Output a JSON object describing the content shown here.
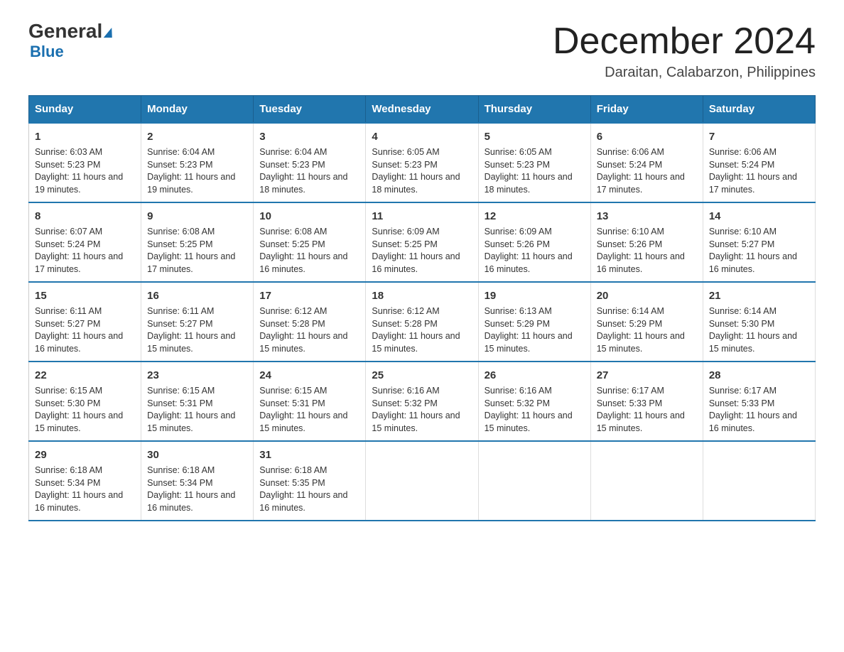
{
  "header": {
    "logo_general": "General",
    "logo_blue": "Blue",
    "month_title": "December 2024",
    "location": "Daraitan, Calabarzon, Philippines"
  },
  "days_of_week": [
    "Sunday",
    "Monday",
    "Tuesday",
    "Wednesday",
    "Thursday",
    "Friday",
    "Saturday"
  ],
  "weeks": [
    [
      {
        "day": "1",
        "sunrise": "6:03 AM",
        "sunset": "5:23 PM",
        "daylight": "11 hours and 19 minutes."
      },
      {
        "day": "2",
        "sunrise": "6:04 AM",
        "sunset": "5:23 PM",
        "daylight": "11 hours and 19 minutes."
      },
      {
        "day": "3",
        "sunrise": "6:04 AM",
        "sunset": "5:23 PM",
        "daylight": "11 hours and 18 minutes."
      },
      {
        "day": "4",
        "sunrise": "6:05 AM",
        "sunset": "5:23 PM",
        "daylight": "11 hours and 18 minutes."
      },
      {
        "day": "5",
        "sunrise": "6:05 AM",
        "sunset": "5:23 PM",
        "daylight": "11 hours and 18 minutes."
      },
      {
        "day": "6",
        "sunrise": "6:06 AM",
        "sunset": "5:24 PM",
        "daylight": "11 hours and 17 minutes."
      },
      {
        "day": "7",
        "sunrise": "6:06 AM",
        "sunset": "5:24 PM",
        "daylight": "11 hours and 17 minutes."
      }
    ],
    [
      {
        "day": "8",
        "sunrise": "6:07 AM",
        "sunset": "5:24 PM",
        "daylight": "11 hours and 17 minutes."
      },
      {
        "day": "9",
        "sunrise": "6:08 AM",
        "sunset": "5:25 PM",
        "daylight": "11 hours and 17 minutes."
      },
      {
        "day": "10",
        "sunrise": "6:08 AM",
        "sunset": "5:25 PM",
        "daylight": "11 hours and 16 minutes."
      },
      {
        "day": "11",
        "sunrise": "6:09 AM",
        "sunset": "5:25 PM",
        "daylight": "11 hours and 16 minutes."
      },
      {
        "day": "12",
        "sunrise": "6:09 AM",
        "sunset": "5:26 PM",
        "daylight": "11 hours and 16 minutes."
      },
      {
        "day": "13",
        "sunrise": "6:10 AM",
        "sunset": "5:26 PM",
        "daylight": "11 hours and 16 minutes."
      },
      {
        "day": "14",
        "sunrise": "6:10 AM",
        "sunset": "5:27 PM",
        "daylight": "11 hours and 16 minutes."
      }
    ],
    [
      {
        "day": "15",
        "sunrise": "6:11 AM",
        "sunset": "5:27 PM",
        "daylight": "11 hours and 16 minutes."
      },
      {
        "day": "16",
        "sunrise": "6:11 AM",
        "sunset": "5:27 PM",
        "daylight": "11 hours and 15 minutes."
      },
      {
        "day": "17",
        "sunrise": "6:12 AM",
        "sunset": "5:28 PM",
        "daylight": "11 hours and 15 minutes."
      },
      {
        "day": "18",
        "sunrise": "6:12 AM",
        "sunset": "5:28 PM",
        "daylight": "11 hours and 15 minutes."
      },
      {
        "day": "19",
        "sunrise": "6:13 AM",
        "sunset": "5:29 PM",
        "daylight": "11 hours and 15 minutes."
      },
      {
        "day": "20",
        "sunrise": "6:14 AM",
        "sunset": "5:29 PM",
        "daylight": "11 hours and 15 minutes."
      },
      {
        "day": "21",
        "sunrise": "6:14 AM",
        "sunset": "5:30 PM",
        "daylight": "11 hours and 15 minutes."
      }
    ],
    [
      {
        "day": "22",
        "sunrise": "6:15 AM",
        "sunset": "5:30 PM",
        "daylight": "11 hours and 15 minutes."
      },
      {
        "day": "23",
        "sunrise": "6:15 AM",
        "sunset": "5:31 PM",
        "daylight": "11 hours and 15 minutes."
      },
      {
        "day": "24",
        "sunrise": "6:15 AM",
        "sunset": "5:31 PM",
        "daylight": "11 hours and 15 minutes."
      },
      {
        "day": "25",
        "sunrise": "6:16 AM",
        "sunset": "5:32 PM",
        "daylight": "11 hours and 15 minutes."
      },
      {
        "day": "26",
        "sunrise": "6:16 AM",
        "sunset": "5:32 PM",
        "daylight": "11 hours and 15 minutes."
      },
      {
        "day": "27",
        "sunrise": "6:17 AM",
        "sunset": "5:33 PM",
        "daylight": "11 hours and 15 minutes."
      },
      {
        "day": "28",
        "sunrise": "6:17 AM",
        "sunset": "5:33 PM",
        "daylight": "11 hours and 16 minutes."
      }
    ],
    [
      {
        "day": "29",
        "sunrise": "6:18 AM",
        "sunset": "5:34 PM",
        "daylight": "11 hours and 16 minutes."
      },
      {
        "day": "30",
        "sunrise": "6:18 AM",
        "sunset": "5:34 PM",
        "daylight": "11 hours and 16 minutes."
      },
      {
        "day": "31",
        "sunrise": "6:18 AM",
        "sunset": "5:35 PM",
        "daylight": "11 hours and 16 minutes."
      },
      null,
      null,
      null,
      null
    ]
  ],
  "labels": {
    "sunrise": "Sunrise:",
    "sunset": "Sunset:",
    "daylight": "Daylight:"
  }
}
